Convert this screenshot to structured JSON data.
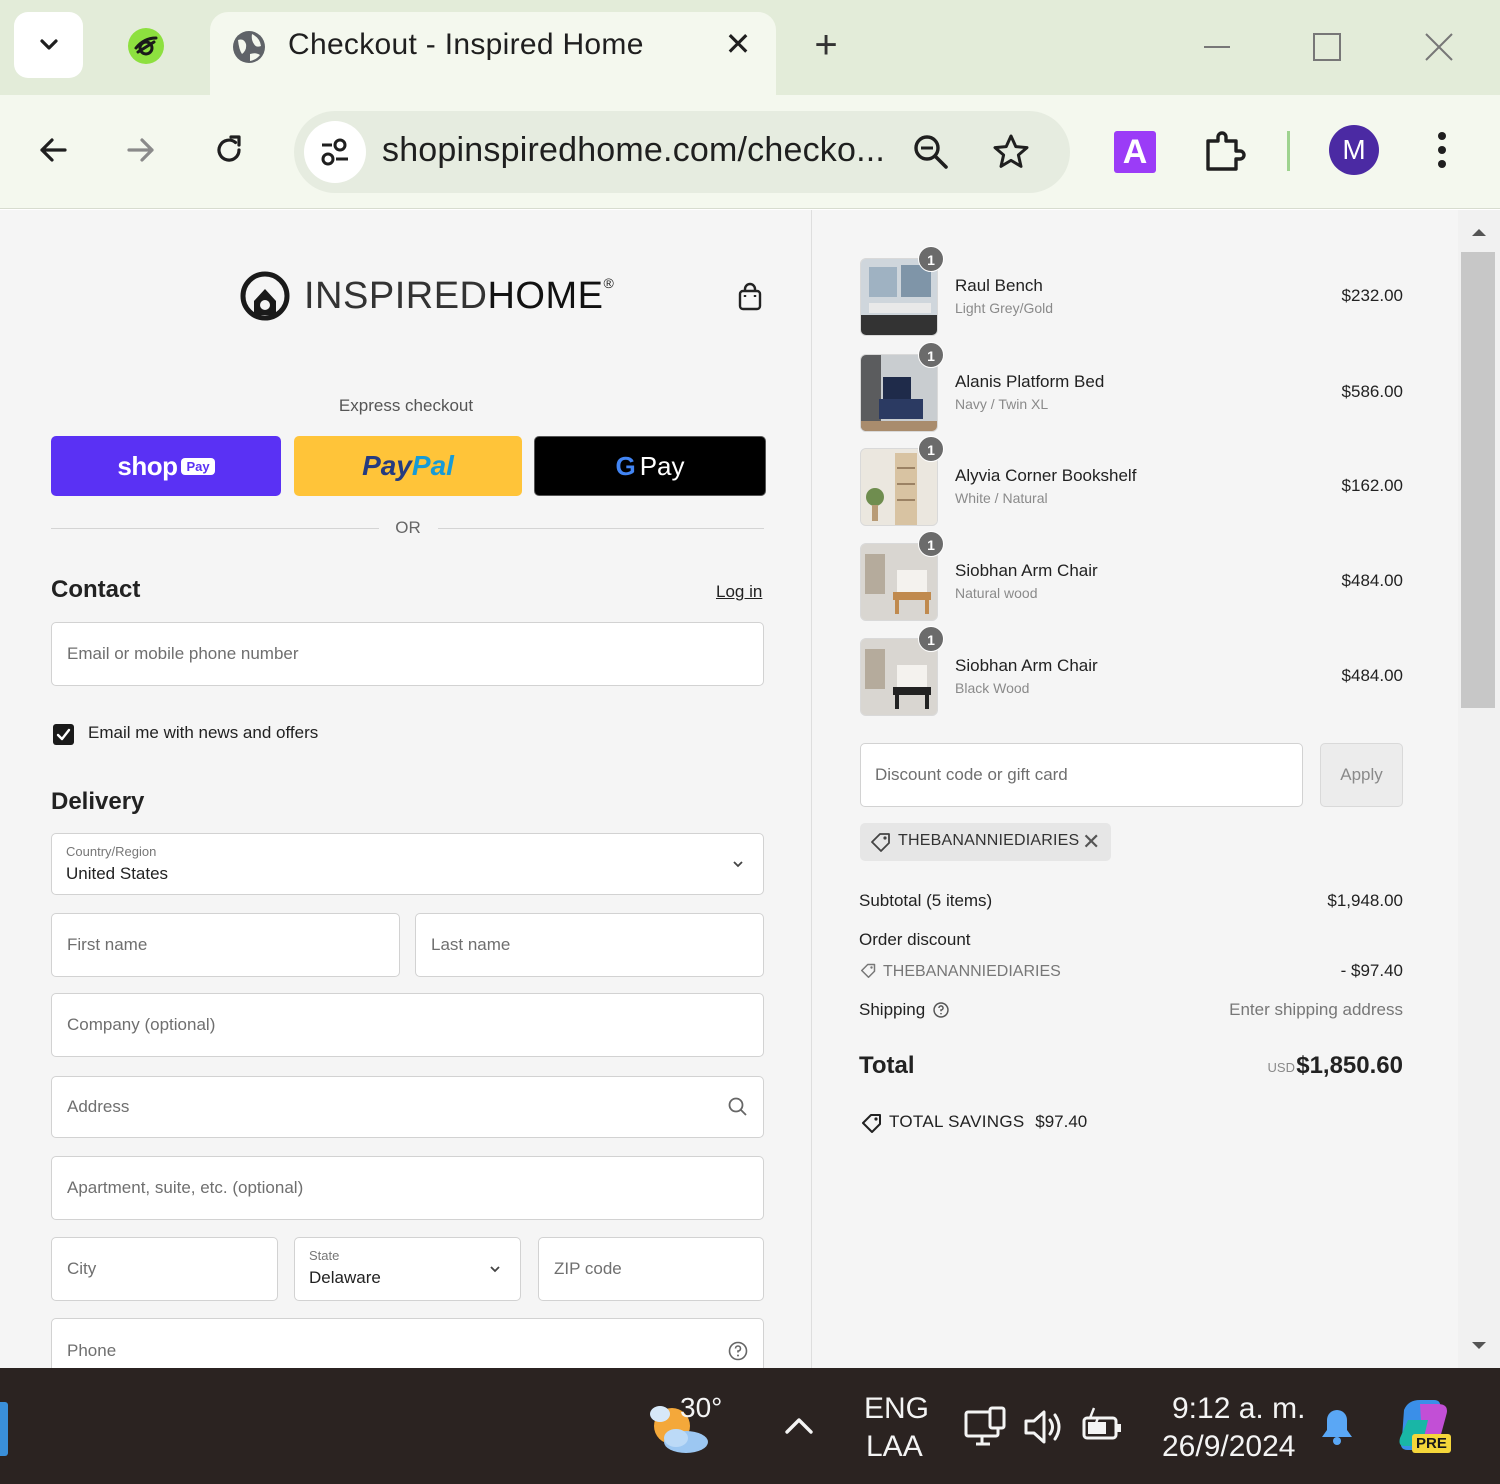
{
  "browser": {
    "tab_title": "Checkout - Inspired Home",
    "tab_close": "✕",
    "new_tab": "+",
    "url": "shopinspiredhome.com/checko...",
    "extension_label": "A",
    "profile_initial": "M"
  },
  "store": {
    "logo_thin": "INSPIRED",
    "logo_bold": "HOME",
    "logo_mark": "®"
  },
  "express": {
    "label": "Express checkout",
    "shop_pay_label": "shop",
    "shop_pay_badge": "Pay",
    "paypal_label_1": "Pay",
    "paypal_label_2": "Pal",
    "gpay_g": "G",
    "gpay_label": "Pay",
    "or_label": "OR"
  },
  "contact": {
    "title": "Contact",
    "login_label": "Log in",
    "email_placeholder": "Email or mobile phone number",
    "newsletter_label": "Email me with news and offers",
    "newsletter_checked": true
  },
  "delivery": {
    "title": "Delivery",
    "country_label": "Country/Region",
    "country_value": "United States",
    "first_name_placeholder": "First name",
    "last_name_placeholder": "Last name",
    "company_placeholder": "Company (optional)",
    "address_placeholder": "Address",
    "apartment_placeholder": "Apartment, suite, etc. (optional)",
    "city_placeholder": "City",
    "state_label": "State",
    "state_value": "Delaware",
    "zip_placeholder": "ZIP code",
    "phone_placeholder": "Phone"
  },
  "order": {
    "items": [
      {
        "name": "Raul Bench",
        "variant": "Light Grey/Gold",
        "price": "$232.00",
        "qty": "1"
      },
      {
        "name": "Alanis Platform Bed",
        "variant": "Navy / Twin XL",
        "price": "$586.00",
        "qty": "1"
      },
      {
        "name": "Alyvia Corner Bookshelf",
        "variant": "White / Natural",
        "price": "$162.00",
        "qty": "1"
      },
      {
        "name": "Siobhan Arm Chair",
        "variant": "Natural wood",
        "price": "$484.00",
        "qty": "1"
      },
      {
        "name": "Siobhan Arm Chair",
        "variant": "Black Wood",
        "price": "$484.00",
        "qty": "1"
      }
    ],
    "discount_placeholder": "Discount code or gift card",
    "apply_label": "Apply",
    "applied_code": "THEBANANNIEDIARIES",
    "remove_code": "✕",
    "subtotal_label": "Subtotal (5 items)",
    "subtotal_value": "$1,948.00",
    "order_discount_label": "Order discount",
    "discount_code": "THEBANANNIEDIARIES",
    "discount_value": "- $97.40",
    "shipping_label": "Shipping",
    "shipping_value": "Enter shipping address",
    "total_label": "Total",
    "currency": "USD",
    "total_value": "$1,850.60",
    "savings_label": "TOTAL SAVINGS",
    "savings_value": "$97.40"
  },
  "taskbar": {
    "weather_temp": "30°",
    "language_1": "ENG",
    "language_2": "LAA",
    "time": "9:12 a. m.",
    "date": "26/9/2024",
    "copilot_badge": "PRE"
  }
}
